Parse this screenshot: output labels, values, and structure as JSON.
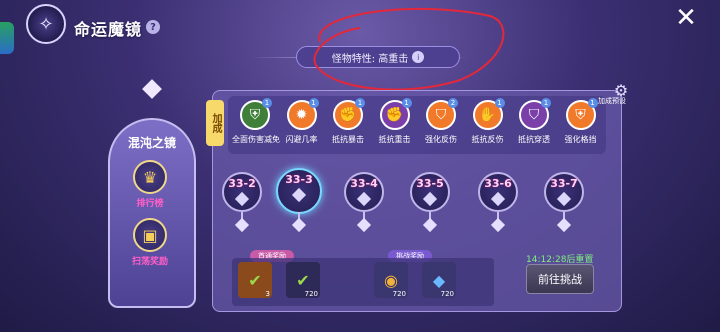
{
  "header": {
    "title": "命运魔镜",
    "help": "?",
    "close": "✕",
    "logo_icon": "mirror-crest-icon"
  },
  "trait": {
    "label": "怪物特性: 高重击",
    "icon": "info-icon"
  },
  "mirror": {
    "title": "混沌之镜",
    "buttons": [
      {
        "label": "排行榜",
        "icon": "trophy-icon"
      },
      {
        "label": "扫荡奖励",
        "icon": "chest-icon"
      }
    ]
  },
  "bonus": {
    "tag": "加成",
    "settings_label": "加成预设",
    "items": [
      {
        "name": "全面伤害减免",
        "level": "1",
        "color": "#3f7f3a"
      },
      {
        "name": "闪避几率",
        "level": "1",
        "color": "#f07a2a"
      },
      {
        "name": "抵抗暴击",
        "level": "1",
        "color": "#f07a2a"
      },
      {
        "name": "抵抗重击",
        "level": "1",
        "color": "#7a3fa8"
      },
      {
        "name": "强化反伤",
        "level": "2",
        "color": "#f07a2a"
      },
      {
        "name": "抵抗反伤",
        "level": "1",
        "color": "#f07a2a"
      },
      {
        "name": "抵抗穿透",
        "level": "1",
        "color": "#7a3fa8"
      },
      {
        "name": "强化格挡",
        "level": "1",
        "color": "#f07a2a"
      }
    ]
  },
  "stages": [
    {
      "code": "33-2",
      "active": false
    },
    {
      "code": "33-3",
      "active": true
    },
    {
      "code": "33-4",
      "active": false
    },
    {
      "code": "33-5",
      "active": false
    },
    {
      "code": "33-6",
      "active": false
    },
    {
      "code": "33-7",
      "active": false
    }
  ],
  "rewards": {
    "first_clear_label": "首通奖励",
    "challenge_label": "挑战奖励",
    "first_clear": [
      {
        "qty": "3",
        "icon": "check-badge-icon",
        "color": "#8a4a1c"
      },
      {
        "qty": "720",
        "icon": "check-coin-icon",
        "color": "#2d2a58"
      }
    ],
    "challenge": [
      {
        "qty": "720",
        "icon": "gold-coin-icon",
        "color": "#3a3670"
      },
      {
        "qty": "720",
        "icon": "blue-crystal-icon",
        "color": "#3a3670"
      }
    ]
  },
  "reset_text": "14:12:28后重置",
  "challenge_button": "前往挑战"
}
